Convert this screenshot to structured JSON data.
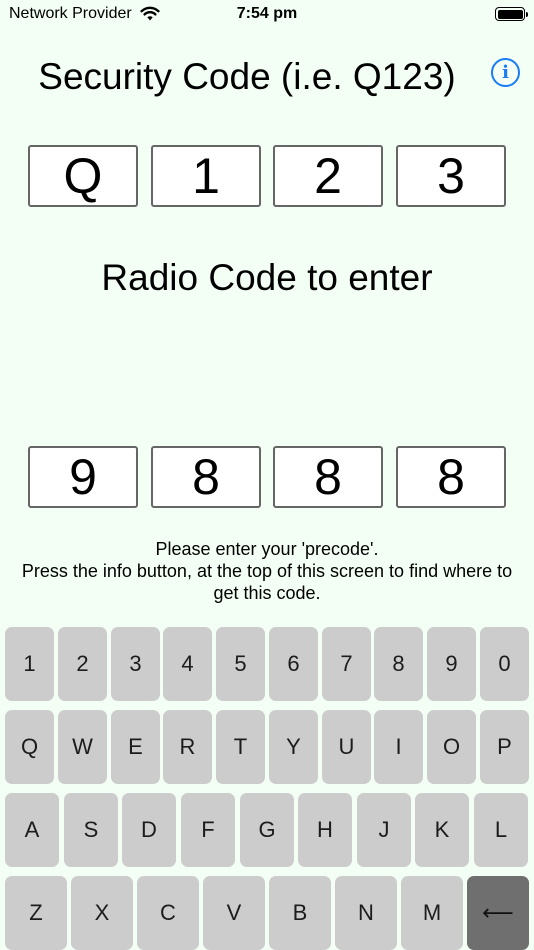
{
  "status": {
    "carrier": "Network Provider",
    "time": "7:54 pm"
  },
  "header": {
    "title": "Security Code (i.e. Q123)",
    "info_glyph": "i"
  },
  "security_code": [
    "Q",
    "1",
    "2",
    "3"
  ],
  "radio_section": {
    "title": "Radio Code to enter",
    "code": [
      "9",
      "8",
      "8",
      "8"
    ]
  },
  "instructions": {
    "line1": "Please enter your 'precode'.",
    "line2": "Press the info button, at the top of this screen to find where to get this code."
  },
  "keyboard": {
    "row1": [
      "1",
      "2",
      "3",
      "4",
      "5",
      "6",
      "7",
      "8",
      "9",
      "0"
    ],
    "row2": [
      "Q",
      "W",
      "E",
      "R",
      "T",
      "Y",
      "U",
      "I",
      "O",
      "P"
    ],
    "row3": [
      "A",
      "S",
      "D",
      "F",
      "G",
      "H",
      "J",
      "K",
      "L"
    ],
    "row4": [
      "Z",
      "X",
      "C",
      "V",
      "B",
      "N",
      "M"
    ],
    "backspace_glyph": "⟵"
  },
  "colors": {
    "background": "#f3fff5",
    "accent": "#1a7cf5",
    "key": "#cccccc",
    "key_dark": "#6f6f6f"
  }
}
